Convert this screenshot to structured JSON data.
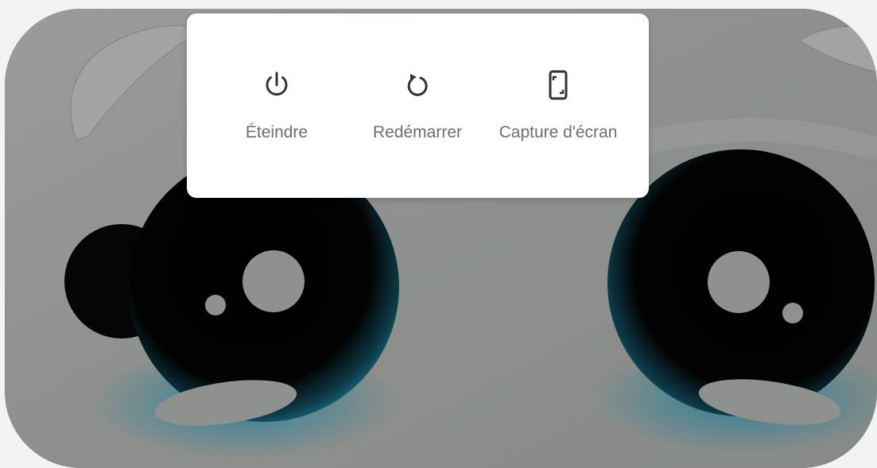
{
  "power_menu": {
    "actions": [
      {
        "label": "Éteindre",
        "icon": "power-icon"
      },
      {
        "label": "Redémarrer",
        "icon": "restart-icon"
      },
      {
        "label": "Capture d'écran",
        "icon": "screenshot-icon"
      }
    ]
  },
  "colors": {
    "wallpaper_gray": "#8e918e",
    "eye_black": "#050505",
    "eye_blue_glow": "#1c7f9c",
    "menu_background": "#ffffff",
    "label_gray": "#6e6e6e",
    "icon_dark": "#333333"
  }
}
